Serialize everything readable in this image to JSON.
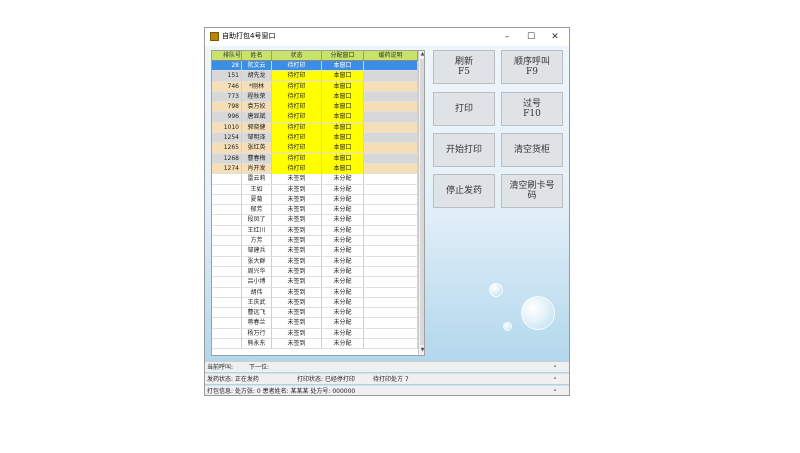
{
  "window": {
    "title": "自助打包4号窗口",
    "minimize": "–",
    "maximize": "☐",
    "close": "✕"
  },
  "grid": {
    "headers": [
      "排队号",
      "姓名",
      "状态",
      "分配窗口",
      "缓药说明"
    ],
    "rows": [
      {
        "queue": "28",
        "name": "阮文云",
        "status": "待打印",
        "window": "本窗口",
        "note": "",
        "style": "selected"
      },
      {
        "queue": "151",
        "name": "胡先龙",
        "status": "待打印",
        "window": "本窗口",
        "note": "",
        "style": "gray"
      },
      {
        "queue": "746",
        "name": "*刚林",
        "status": "待打印",
        "window": "本窗口",
        "note": "",
        "style": "peach"
      },
      {
        "queue": "773",
        "name": "程秋荣",
        "status": "待打印",
        "window": "本窗口",
        "note": "",
        "style": "gray"
      },
      {
        "queue": "798",
        "name": "袁万姣",
        "status": "待打印",
        "window": "本窗口",
        "note": "",
        "style": "peach"
      },
      {
        "queue": "996",
        "name": "唐显斌",
        "status": "待打印",
        "window": "本窗口",
        "note": "",
        "style": "gray"
      },
      {
        "queue": "1010",
        "name": "郭晓健",
        "status": "待打印",
        "window": "本窗口",
        "note": "",
        "style": "peach"
      },
      {
        "queue": "1254",
        "name": "邹明泽",
        "status": "待打印",
        "window": "本窗口",
        "note": "",
        "style": "gray"
      },
      {
        "queue": "1265",
        "name": "张红英",
        "status": "待打印",
        "window": "本窗口",
        "note": "",
        "style": "peach"
      },
      {
        "queue": "1268",
        "name": "曹春梅",
        "status": "待打印",
        "window": "本窗口",
        "note": "",
        "style": "gray"
      },
      {
        "queue": "1274",
        "name": "肖开发",
        "status": "待打印",
        "window": "本窗口",
        "note": "",
        "style": "peach"
      },
      {
        "queue": "",
        "name": "雷云莉",
        "status": "未签到",
        "window": "未分配",
        "note": "",
        "style": "plain"
      },
      {
        "queue": "",
        "name": "王如",
        "status": "未签到",
        "window": "未分配",
        "note": "",
        "style": "plain"
      },
      {
        "queue": "",
        "name": "夏菊",
        "status": "未签到",
        "window": "未分配",
        "note": "",
        "style": "plain"
      },
      {
        "queue": "",
        "name": "郁芳",
        "status": "未签到",
        "window": "未分配",
        "note": "",
        "style": "plain"
      },
      {
        "queue": "",
        "name": "段凤了",
        "status": "未签到",
        "window": "未分配",
        "note": "",
        "style": "plain"
      },
      {
        "queue": "",
        "name": "王红川",
        "status": "未签到",
        "window": "未分配",
        "note": "",
        "style": "plain"
      },
      {
        "queue": "",
        "name": "方芳",
        "status": "未签到",
        "window": "未分配",
        "note": "",
        "style": "plain"
      },
      {
        "queue": "",
        "name": "邹建兵",
        "status": "未签到",
        "window": "未分配",
        "note": "",
        "style": "plain"
      },
      {
        "queue": "",
        "name": "张大群",
        "status": "未签到",
        "window": "未分配",
        "note": "",
        "style": "plain"
      },
      {
        "queue": "",
        "name": "周兴华",
        "status": "未签到",
        "window": "未分配",
        "note": "",
        "style": "plain"
      },
      {
        "queue": "",
        "name": "吕小博",
        "status": "未签到",
        "window": "未分配",
        "note": "",
        "style": "plain"
      },
      {
        "queue": "",
        "name": "胡伟",
        "status": "未签到",
        "window": "未分配",
        "note": "",
        "style": "plain"
      },
      {
        "queue": "",
        "name": "王庆武",
        "status": "未签到",
        "window": "未分配",
        "note": "",
        "style": "plain"
      },
      {
        "queue": "",
        "name": "曹远飞",
        "status": "未签到",
        "window": "未分配",
        "note": "",
        "style": "plain"
      },
      {
        "queue": "",
        "name": "蒋春兰",
        "status": "未签到",
        "window": "未分配",
        "note": "",
        "style": "plain"
      },
      {
        "queue": "",
        "name": "杨万行",
        "status": "未签到",
        "window": "未分配",
        "note": "",
        "style": "plain"
      },
      {
        "queue": "",
        "name": "熊永东",
        "status": "未签到",
        "window": "未分配",
        "note": "",
        "style": "plain"
      }
    ]
  },
  "buttons": {
    "refresh": "刷新\nF5",
    "seq_call": "顺序呼叫\nF9",
    "print": "打印",
    "skip": "过号\nF10",
    "start_print": "开始打印",
    "clear_cabinet": "清空货柜",
    "stop_dispense": "停止发药",
    "clear_card": "清空刷卡号\n码"
  },
  "status": {
    "current_call_label": "当前呼叫:",
    "next_label": "下一位:",
    "dispense_state": "发药状态: 正在发药",
    "print_state": "打印状态: 已经停打印",
    "pending_rx": "待打印处方 7",
    "print_info": "打包信息: 处方张:  0  患者姓名: 某某某  处方号: 000000"
  },
  "colors": {
    "selected_row": "#3a8ee6",
    "status_yellow": "#ffff00",
    "header_green": "#c8e26a",
    "gray_row": "#d8d8d8",
    "peach_row": "#f6dfb6"
  }
}
